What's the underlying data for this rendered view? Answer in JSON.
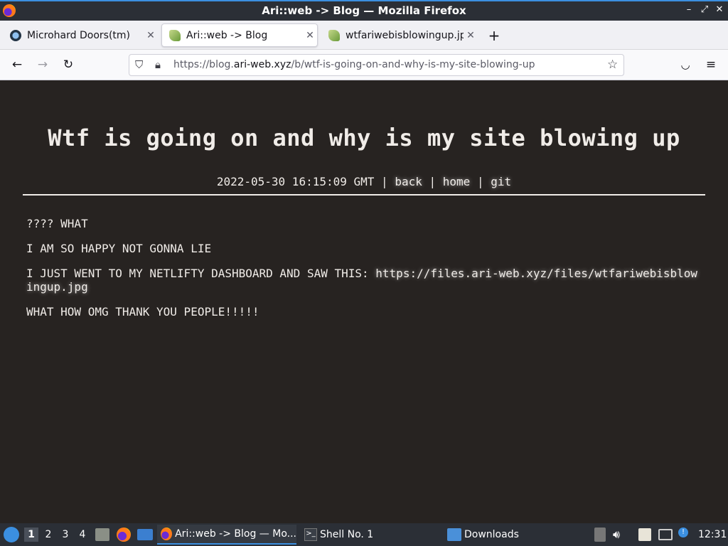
{
  "window": {
    "title": "Ari::web -> Blog — Mozilla Firefox"
  },
  "tabs": [
    {
      "label": "Microhard Doors(tm)",
      "active": false
    },
    {
      "label": "Ari::web -> Blog",
      "active": true
    },
    {
      "label": "wtfariwebisblowingup.jpg",
      "active": false
    }
  ],
  "urlbar": {
    "scheme": "https://blog.",
    "domain": "ari-web.xyz",
    "path": "/b/wtf-is-going-on-and-why-is-my-site-blowing-up"
  },
  "post": {
    "title": "Wtf is going on and why is my site blowing up",
    "timestamp": "2022-05-30 16:15:09 GMT",
    "sep": "|",
    "links": {
      "back": "back",
      "home": "home",
      "git": "git"
    },
    "paragraphs": {
      "p1": "???? WHAT",
      "p2": "I AM SO HAPPY NOT GONNA LIE",
      "p3_text": "I JUST WENT TO MY NETLIFTY DASHBOARD AND SAW THIS: ",
      "p3_link": "https://files.ari-web.xyz/files/wtfariwebisblowingup.jpg",
      "p4": "WHAT HOW OMG THANK YOU PEOPLE!!!!!"
    }
  },
  "taskbar": {
    "workspaces": [
      "1",
      "2",
      "3",
      "4"
    ],
    "tasks": {
      "firefox": "Ari::web -> Blog — Mo...",
      "shell": "Shell No. 1",
      "downloads": "Downloads"
    },
    "clock": "12:31"
  }
}
